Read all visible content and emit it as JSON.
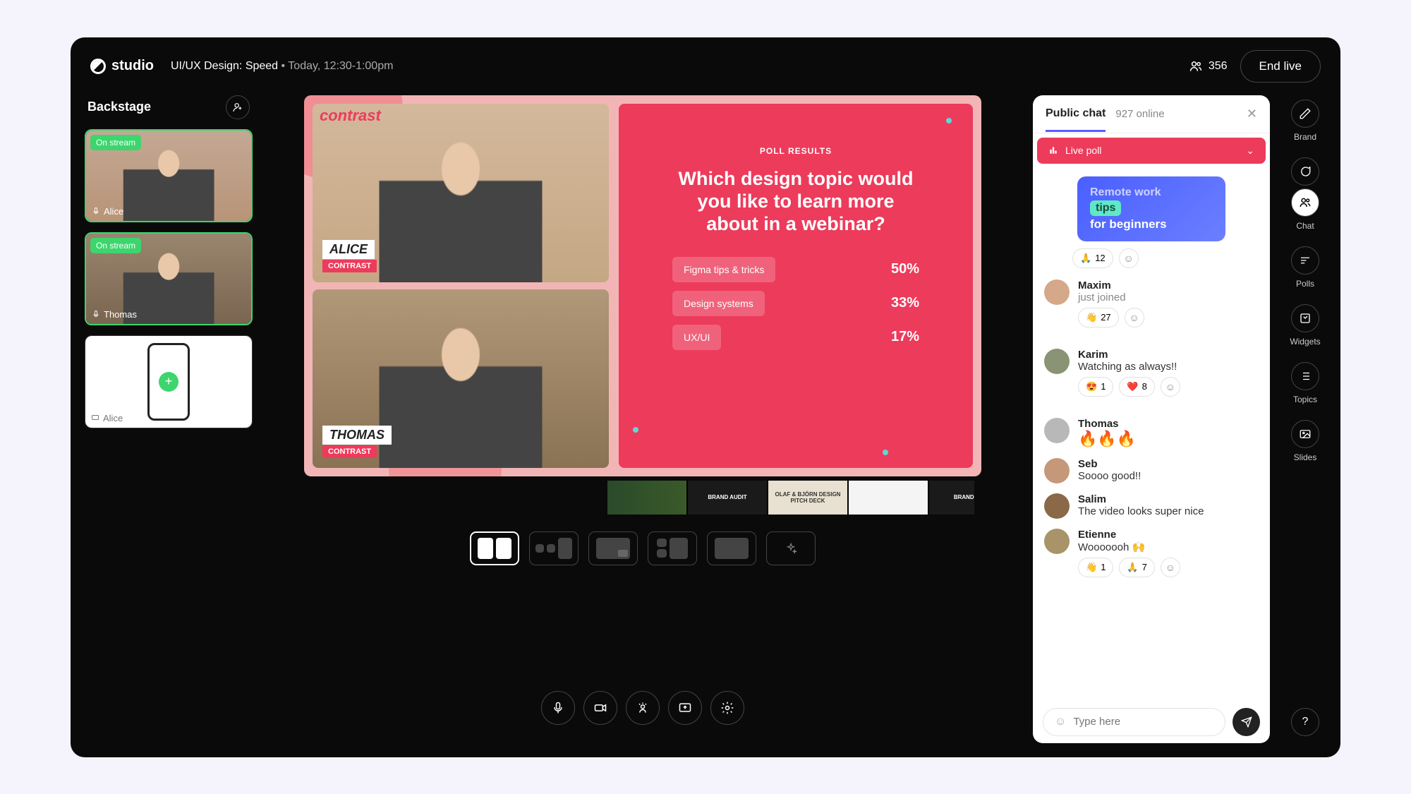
{
  "header": {
    "logo_text": "studio",
    "session_title": "UI/UX Design: Speed",
    "session_time": "Today, 12:30-1:00pm",
    "viewer_count": "356",
    "end_button": "End live"
  },
  "backstage": {
    "title": "Backstage",
    "items": [
      {
        "name": "Alice",
        "badge": "On stream",
        "on_stream": true
      },
      {
        "name": "Thomas",
        "badge": "On stream",
        "on_stream": true
      },
      {
        "name": "Alice",
        "on_stream": false,
        "type": "screen"
      }
    ]
  },
  "stage": {
    "brand": "contrast",
    "speakers": [
      {
        "name": "ALICE",
        "company": "CONTRAST"
      },
      {
        "name": "THOMAS",
        "company": "CONTRAST"
      }
    ],
    "poll": {
      "label": "POLL RESULTS",
      "question": "Which design topic would you like to learn more about in a webinar?",
      "options": [
        {
          "text": "Figma tips & tricks",
          "pct": "50%"
        },
        {
          "text": "Design systems",
          "pct": "33%"
        },
        {
          "text": "UX/UI",
          "pct": "17%"
        }
      ]
    },
    "slides": [
      "",
      "BRAND AUDIT",
      "OLAF & BJÖRN DESIGN PITCH DECK",
      "",
      "BRAND AU"
    ]
  },
  "chat": {
    "tab": "Public chat",
    "online": "927 online",
    "live_poll_label": "Live poll",
    "card": {
      "line1": "Remote work",
      "tips": "tips",
      "line2": "for beginners"
    },
    "card_reactions": [
      {
        "emoji": "🙏",
        "count": "12"
      }
    ],
    "messages": [
      {
        "name": "Maxim",
        "text": "just joined",
        "sub": true,
        "reactions": [
          {
            "emoji": "👋",
            "count": "27"
          }
        ]
      },
      {
        "name": "Karim",
        "text": "Watching as always!!",
        "reactions": [
          {
            "emoji": "😍",
            "count": "1"
          },
          {
            "emoji": "❤️",
            "count": "8"
          }
        ]
      },
      {
        "name": "Thomas",
        "text": "🔥🔥🔥"
      },
      {
        "name": "Seb",
        "text": "Soooo good!!"
      },
      {
        "name": "Salim",
        "text": "The video looks super nice"
      },
      {
        "name": "Etienne",
        "text": "Wooooooh 🙌",
        "reactions": [
          {
            "emoji": "👋",
            "count": "1"
          },
          {
            "emoji": "🙏",
            "count": "7"
          }
        ]
      }
    ],
    "input_placeholder": "Type here"
  },
  "rail": {
    "items": [
      {
        "label": "Brand",
        "icon": "pencil"
      },
      {
        "label": "Chat",
        "icon": "chat",
        "active": true
      },
      {
        "label": "Polls",
        "icon": "poll"
      },
      {
        "label": "Widgets",
        "icon": "widget"
      },
      {
        "label": "Topics",
        "icon": "list"
      },
      {
        "label": "Slides",
        "icon": "image"
      }
    ]
  }
}
